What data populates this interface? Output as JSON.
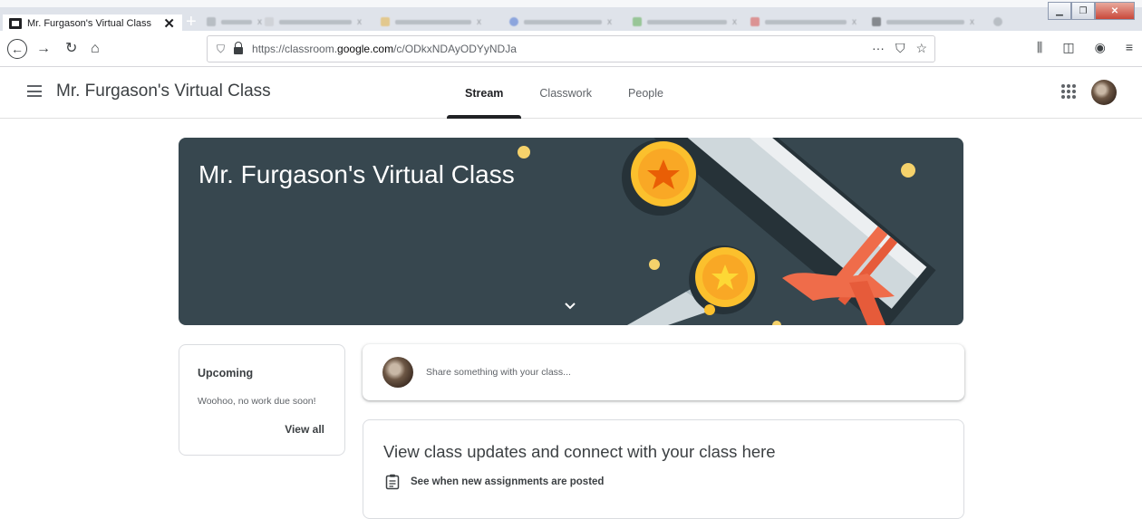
{
  "browser": {
    "active_tab_title": "Mr. Furgason's Virtual Class",
    "url_prefix": "https://classroom.",
    "url_domain": "google.com",
    "url_path": "/c/ODkxNDAyODYyNDJa",
    "page_actions": "···"
  },
  "header": {
    "title": "Mr. Furgason's Virtual Class",
    "tabs": [
      {
        "label": "Stream",
        "active": true
      },
      {
        "label": "Classwork",
        "active": false
      },
      {
        "label": "People",
        "active": false
      }
    ]
  },
  "banner": {
    "title": "Mr. Furgason's Virtual Class",
    "background_color": "#37474f"
  },
  "upcoming": {
    "title": "Upcoming",
    "message": "Woohoo, no work due soon!",
    "view_all": "View all"
  },
  "share": {
    "placeholder": "Share something with your class..."
  },
  "updates": {
    "title": "View class updates and connect with your class here",
    "row_text": "See when new assignments are posted"
  },
  "icons": {
    "menu": "hamburger-menu-icon",
    "apps": "google-apps-icon",
    "expand": "chevron-down-icon",
    "assignment": "assignment-icon"
  }
}
